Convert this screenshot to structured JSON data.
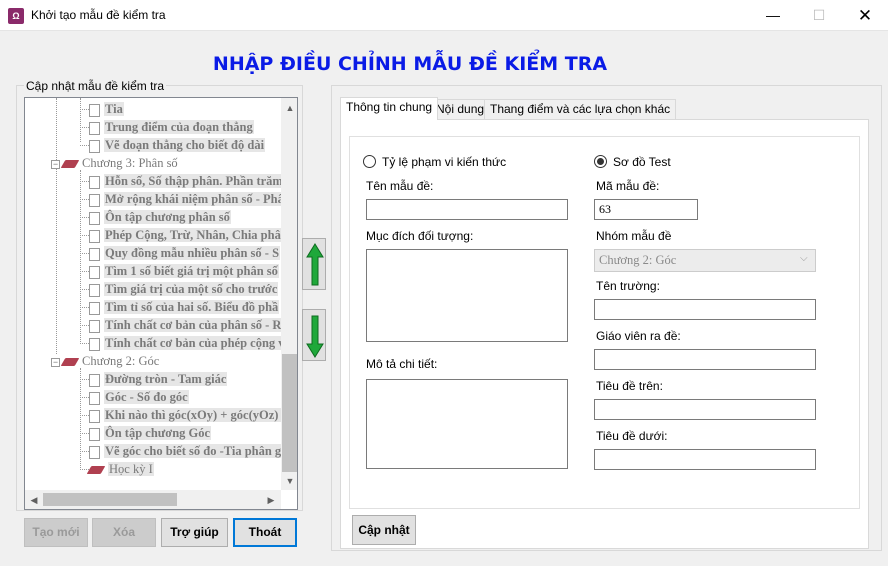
{
  "window": {
    "title": "Khởi tạo mẫu đề kiểm tra",
    "minimize_symbol": "—",
    "maximize_symbol": "☐",
    "close_symbol": "✕"
  },
  "heading": "NHẬP ĐIỀU CHỈNH MẪU ĐỀ KIỂM TRA",
  "left_group": {
    "label": "Cập nhật mẫu đề kiểm tra",
    "tree": [
      {
        "type": "lesson",
        "text": "Tia"
      },
      {
        "type": "lesson",
        "text": "Trung điểm của đoạn thẳng"
      },
      {
        "type": "lesson",
        "text": "Vẽ đoạn thẳng cho biết độ dài"
      },
      {
        "type": "chapter",
        "text": "Chương 3: Phân số"
      },
      {
        "type": "lesson",
        "text": "Hỗn số, Số thập phân. Phần trăm"
      },
      {
        "type": "lesson",
        "text": "Mở rộng khái niệm phân số - Phâ"
      },
      {
        "type": "lesson",
        "text": "Ôn tập chương phân số"
      },
      {
        "type": "lesson",
        "text": "Phép Cộng, Trừ, Nhân, Chia  phâ"
      },
      {
        "type": "lesson",
        "text": "Quy đồng mẫu nhiều phân số - S"
      },
      {
        "type": "lesson",
        "text": "Tìm 1 số biết giá trị một phân số"
      },
      {
        "type": "lesson",
        "text": "Tìm giá trị của một số cho trước"
      },
      {
        "type": "lesson",
        "text": "Tìm tỉ số của hai số. Biểu đồ phầ"
      },
      {
        "type": "lesson",
        "text": "Tính chất cơ bản của phân số - Rú"
      },
      {
        "type": "lesson",
        "text": "Tính chất cơ bản của phép cộng v"
      },
      {
        "type": "chapter",
        "text": "Chương 2: Góc"
      },
      {
        "type": "lesson",
        "text": "Đường tròn - Tam giác"
      },
      {
        "type": "lesson",
        "text": "Góc - Số đo góc"
      },
      {
        "type": "lesson",
        "text": "Khi nào thì góc(xOy) + góc(yOz) ="
      },
      {
        "type": "lesson",
        "text": "Ôn tập chương Góc"
      },
      {
        "type": "lesson",
        "text": "Vẽ góc cho biết số đo -Tia phân gi"
      },
      {
        "type": "term",
        "text": "Học kỳ I"
      }
    ],
    "scroll_up": "▲",
    "scroll_down": "▼",
    "scroll_left": "◀",
    "scroll_right": "▶"
  },
  "buttons": {
    "new": "Tạo mới",
    "delete": "Xóa",
    "help": "Trợ giúp",
    "exit": "Thoát",
    "update": "Cập nhật"
  },
  "tabs": [
    "Thông tin chung",
    "Nội dung",
    "Thang điểm và các lựa chọn khác"
  ],
  "form": {
    "radio_scope": "Tỷ lệ phạm vi kiến thức",
    "radio_test_map": "Sơ đồ Test",
    "template_name_label": "Tên mẫu đề:",
    "template_name_value": "",
    "purpose_label": "Mục đích đối tượng:",
    "purpose_value": "",
    "description_label": "Mô tả chi tiết:",
    "description_value": "",
    "template_code_label": "Mã mẫu đề:",
    "template_code_value": "63",
    "group_label": "Nhóm mẫu đề",
    "group_value": "Chương 2: Góc",
    "school_label": "Tên trường:",
    "school_value": "",
    "teacher_label": "Giáo viên ra đề:",
    "teacher_value": "",
    "top_title_label": "Tiêu đề trên:",
    "top_title_value": "",
    "bottom_title_label": "Tiêu đề dưới:",
    "bottom_title_value": ""
  },
  "colors": {
    "heading": "#0a1be6",
    "arrow_green": "#1fa83a",
    "chapter_icon": "#b04050",
    "focus_border": "#0078d7"
  }
}
